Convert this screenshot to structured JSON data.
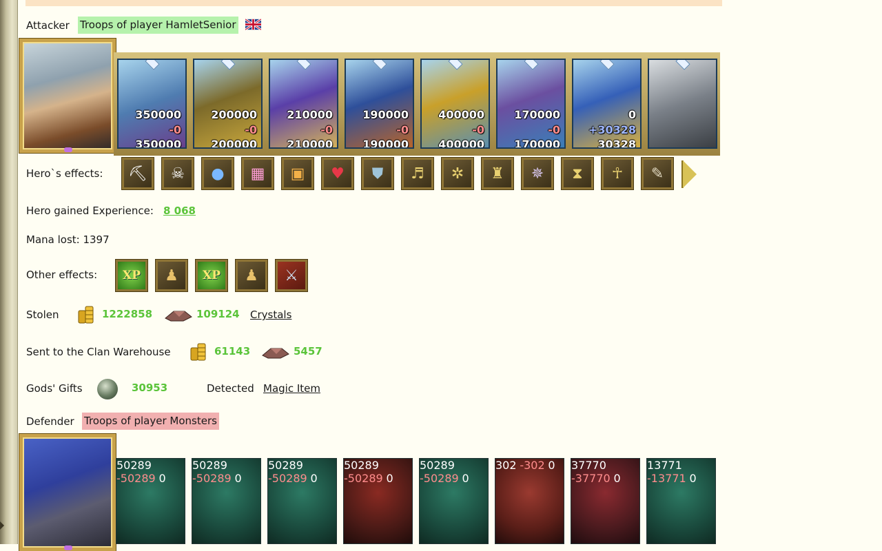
{
  "attacker": {
    "label": "Attacker",
    "troops_label": "Troops of player HamletSenior",
    "flag": "uk-flag-icon",
    "units": [
      {
        "before": "350000",
        "lost": "-0",
        "after": "350000"
      },
      {
        "before": "200000",
        "lost": "-0",
        "after": "200000"
      },
      {
        "before": "210000",
        "lost": "-0",
        "after": "210000"
      },
      {
        "before": "190000",
        "lost": "-0",
        "after": "190000"
      },
      {
        "before": "400000",
        "lost": "-0",
        "after": "400000"
      },
      {
        "before": "170000",
        "lost": "-0",
        "after": "170000"
      },
      {
        "before": "0",
        "gained": "+30328",
        "after": "30328"
      }
    ]
  },
  "hero_effects": {
    "label": "Hero`s effects:",
    "icons": [
      "gold-cart-icon",
      "skull-armor-icon",
      "blue-orb-icon",
      "pink-chest-icon",
      "treasure-chest-icon",
      "heart-icon",
      "shield-icon",
      "golden-harp-icon",
      "spider-amulet-icon",
      "armor-icon",
      "wings-icon",
      "hourglass-icon",
      "ankh-icon",
      "scroll-icon"
    ]
  },
  "experience": {
    "label": "Hero gained Experience:",
    "value": "8 068"
  },
  "mana": {
    "label": "Mana lost: 1397"
  },
  "other_effects": {
    "label": "Other effects:",
    "xp_text": "XP"
  },
  "stolen": {
    "label": "Stolen",
    "gold": "1222858",
    "crystals": "109124",
    "link": "Crystals"
  },
  "clan": {
    "label": "Sent to the Clan Warehouse",
    "gold": "61143",
    "crystals": "5457"
  },
  "gods": {
    "label": "Gods' Gifts",
    "value": "30953",
    "detected_label": "Detected",
    "link": "Magic Item"
  },
  "defender": {
    "label": "Defender",
    "troops_label": "Troops of player Monsters",
    "units": [
      {
        "before": "50289",
        "lost": "-50289",
        "after": "0"
      },
      {
        "before": "50289",
        "lost": "-50289",
        "after": "0"
      },
      {
        "before": "50289",
        "lost": "-50289",
        "after": "0"
      },
      {
        "before": "50289",
        "lost": "-50289",
        "after": "0"
      },
      {
        "before": "50289",
        "lost": "-50289",
        "after": "0"
      },
      {
        "before": "302",
        "lost": "-302",
        "after": "0"
      },
      {
        "before": "37770",
        "lost": "-37770",
        "after": "0"
      },
      {
        "before": "13771",
        "lost": "-13771",
        "after": "0"
      }
    ]
  }
}
